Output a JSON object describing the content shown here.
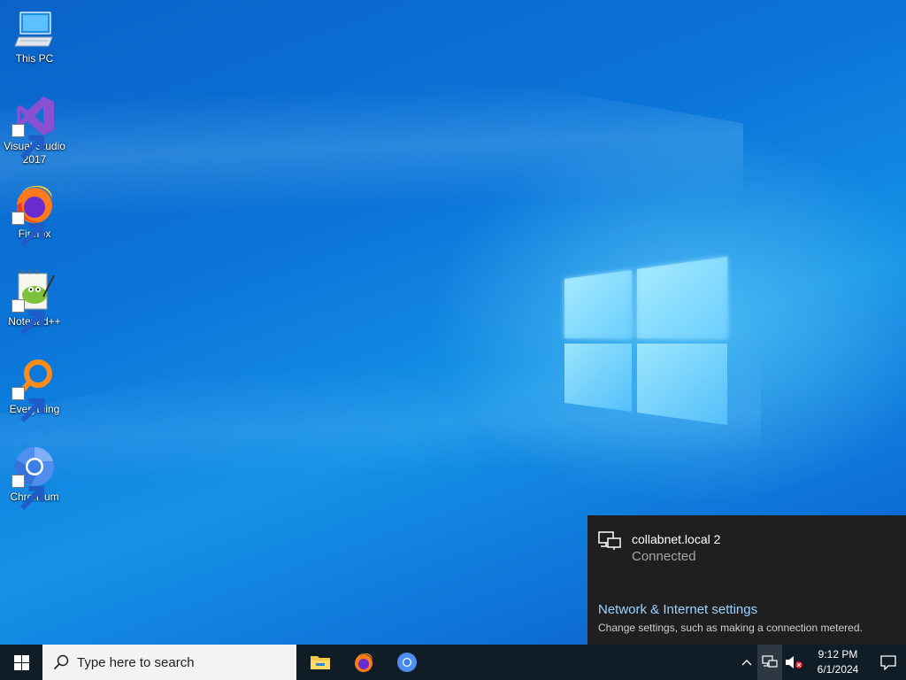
{
  "desktop": {
    "icons": [
      {
        "label": "This PC",
        "icon": "this-pc-icon"
      },
      {
        "label": "Visual Studio 2017",
        "icon": "visual-studio-icon"
      },
      {
        "label": "Firefox",
        "icon": "firefox-icon"
      },
      {
        "label": "Notepad++",
        "icon": "notepad-plus-plus-icon"
      },
      {
        "label": "Everything",
        "icon": "everything-icon"
      },
      {
        "label": "Chromium",
        "icon": "chromium-icon"
      }
    ]
  },
  "network_flyout": {
    "network_name": "collabnet.local 2",
    "status": "Connected",
    "settings_link": "Network & Internet settings",
    "settings_description": "Change settings, such as making a connection metered."
  },
  "taskbar": {
    "search_placeholder": "Type here to search",
    "pinned": [
      "file-explorer-icon",
      "firefox-icon",
      "chromium-icon"
    ],
    "clock_time": "9:12 PM",
    "clock_date": "6/1/2024"
  },
  "colors": {
    "taskbar": "#101c26",
    "flyout_bg": "#1f1f1f",
    "link": "#9dd3ff",
    "accent": "#0b74d8"
  }
}
